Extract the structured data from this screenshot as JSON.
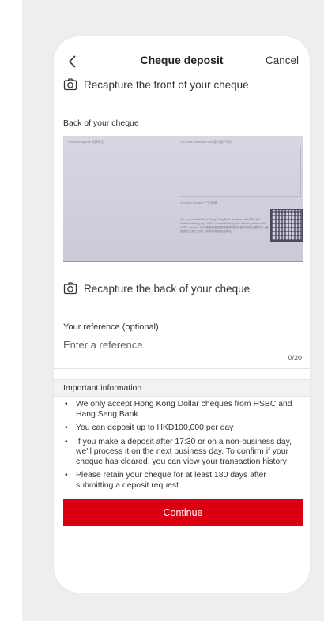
{
  "header": {
    "title": "Cheque deposit",
    "cancel_label": "Cancel"
  },
  "recapture_front_label": "Recapture the front of your cheque",
  "back_section_label": "Back of your cheque",
  "recapture_back_label": "Recapture the back of your cheque",
  "cheque_back_image": {
    "top_left_text": "For clearing use 結算專用",
    "top_right_text": "For bank customer use 銀行客戶專用",
    "account_text": "Account Number 戶口號碼",
    "fine_print": "You can now HSBC or Hang Seng Bank cheques via HSBC HK Mobile Banking app. HSBC Online Banking. For details, please visit HSBC website. 您可透過滙豐香港流動理財應用程式或網上理財存入滙豐或恒生銀行支票。詳情請瀏覽滙豐網站。"
  },
  "reference": {
    "label": "Your reference (optional)",
    "placeholder": "Enter a reference",
    "value": "",
    "counter": "0/20"
  },
  "important_info": {
    "heading": "Important information",
    "bullet": "•",
    "items": [
      "We only accept Hong Kong Dollar cheques from HSBC and Hang Seng Bank",
      "You can deposit up to HKD100,000 per day",
      "If you make a deposit after 17:30 or on a non-business day, we'll process it on the next business day. To confirm if your cheque has cleared, you can view your transaction history",
      "Please retain your cheque for at least 180 days after submitting a deposit request"
    ]
  },
  "continue_label": "Continue",
  "colors": {
    "primary_button": "#db0011",
    "page_background": "#efeeee"
  },
  "icons": {
    "back": "chevron-left-icon",
    "camera": "camera-icon",
    "qr": "qr-code"
  }
}
